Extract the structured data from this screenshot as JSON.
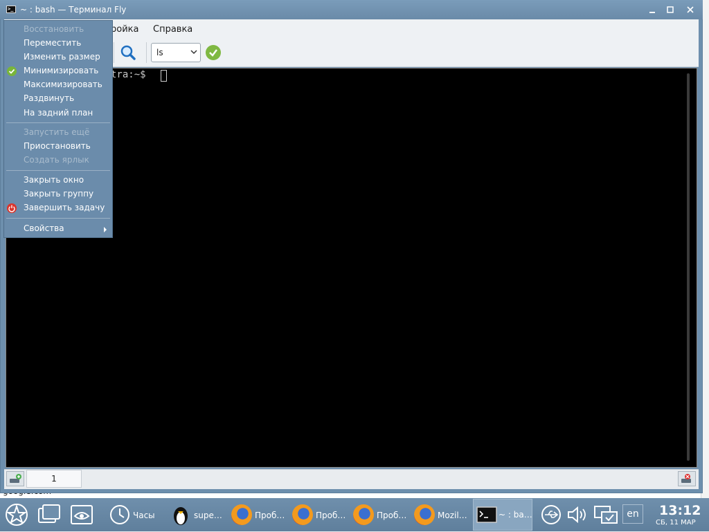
{
  "background": {
    "url_fragment": "google.com"
  },
  "window": {
    "title": "~ : bash — Терминал Fly",
    "icon_text": ">_",
    "buttons": {
      "minimize": "minimize-icon",
      "maximize": "maximize-icon",
      "close": "close-icon"
    }
  },
  "menubar": {
    "items": [
      "ройка",
      "Справка"
    ]
  },
  "toolbar": {
    "command_value": "ls"
  },
  "terminal": {
    "prompt": "tra:~$ "
  },
  "tabs": [
    {
      "label": "1"
    }
  ],
  "context_menu": {
    "items": [
      {
        "label": "Восстановить",
        "disabled": true
      },
      {
        "label": "Переместить",
        "disabled": false
      },
      {
        "label": "Изменить размер",
        "disabled": false
      },
      {
        "label": "Минимизировать",
        "disabled": false,
        "mark": "check-icon"
      },
      {
        "label": "Максимизировать",
        "disabled": false
      },
      {
        "label": "Раздвинуть",
        "disabled": false
      },
      {
        "label": "На задний план",
        "disabled": false
      },
      {
        "label": "Запустить ещё",
        "disabled": true
      },
      {
        "label": "Приостановить",
        "disabled": false
      },
      {
        "label": "Создать ярлык",
        "disabled": true
      },
      {
        "label": "Закрыть окно",
        "disabled": false
      },
      {
        "label": "Закрыть группу",
        "disabled": false
      },
      {
        "label": "Завершить задачу",
        "disabled": false,
        "mark": "power-icon"
      },
      {
        "label": "Свойства",
        "disabled": false,
        "submenu": true
      }
    ]
  },
  "taskbar": {
    "clock_label": "Часы",
    "tasks": [
      {
        "label": "supe…",
        "icon": "penguin-icon"
      },
      {
        "label": "Проб…",
        "icon": "firefox-icon"
      },
      {
        "label": "Проб…",
        "icon": "firefox-icon"
      },
      {
        "label": "Проб…",
        "icon": "firefox-icon"
      },
      {
        "label": "Mozil…",
        "icon": "firefox-icon"
      },
      {
        "label": "~ : ba…",
        "icon": "terminal-icon",
        "active": true
      }
    ],
    "language": "en",
    "time": "13:12",
    "date": "СБ, 11 МАР"
  }
}
